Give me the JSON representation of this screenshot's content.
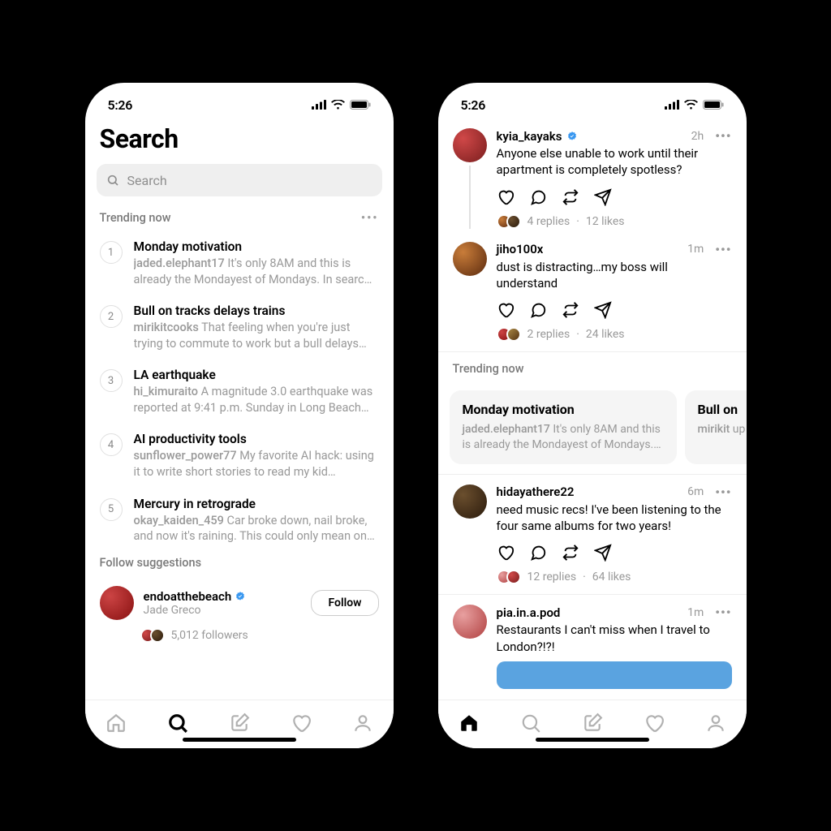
{
  "status": {
    "time": "5:26"
  },
  "left": {
    "title": "Search",
    "search_placeholder": "Search",
    "trending_label": "Trending now",
    "trends": [
      {
        "rank": "1",
        "title": "Monday motivation",
        "author": "jaded.elephant17",
        "preview": "It's only 8AM and this is already the Mondayest of Mondays. In searc…"
      },
      {
        "rank": "2",
        "title": "Bull on tracks delays trains",
        "author": "mirikitcooks",
        "preview": "That feeling when you're just trying to commute to work but a bull delays…"
      },
      {
        "rank": "3",
        "title": "LA earthquake",
        "author": "hi_kimuraito",
        "preview": "A magnitude 3.0 earthquake was reported at 9:41 p.m. Sunday in Long Beach…"
      },
      {
        "rank": "4",
        "title": "AI productivity tools",
        "author": "sunflower_power77",
        "preview": "My favorite AI hack: using it to write short stories to read my kid…"
      },
      {
        "rank": "5",
        "title": "Mercury in retrograde",
        "author": "okay_kaiden_459",
        "preview": "Car broke down, nail broke, and now it's raining. This could only mean on…"
      }
    ],
    "follow_label": "Follow suggestions",
    "suggestion": {
      "name": "endoatthebeach",
      "sub": "Jade Greco",
      "followers": "5,012 followers",
      "button": "Follow"
    }
  },
  "right": {
    "trending_label": "Trending now",
    "cards": [
      {
        "title": "Monday motivation",
        "author": "jaded.elephant17",
        "preview": "It's only 8AM and this is already the Mondayest of Mondays.…"
      },
      {
        "title": "Bull on",
        "author": "mirikit",
        "preview": "up unb"
      }
    ],
    "posts": [
      {
        "name": "kyia_kayaks",
        "time": "2h",
        "text": "Anyone else unable to work until their apartment is completely spotless?",
        "replies": "4 replies",
        "likes": "12 likes",
        "verified": true
      },
      {
        "name": "jiho100x",
        "time": "1m",
        "text": "dust is distracting…my boss will understand",
        "replies": "2 replies",
        "likes": "24 likes"
      },
      {
        "name": "hidayathere22",
        "time": "6m",
        "text": "need music recs! I've been listening to the four same albums for two years!",
        "replies": "12 replies",
        "likes": "64 likes"
      },
      {
        "name": "pia.in.a.pod",
        "time": "1m",
        "text": "Restaurants I can't miss when I travel to London?!?!"
      }
    ]
  }
}
